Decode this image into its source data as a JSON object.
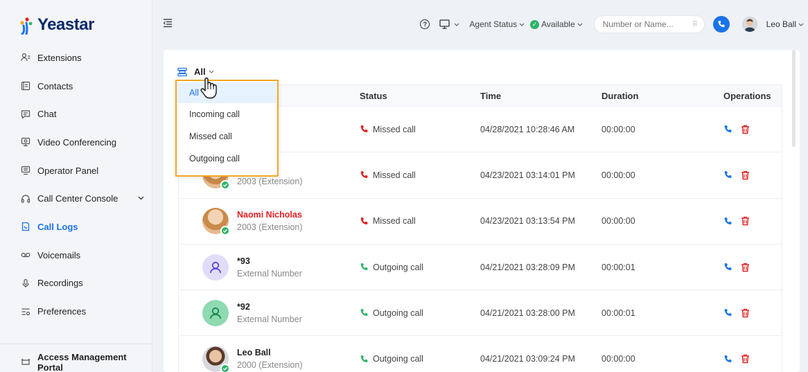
{
  "brand": {
    "name": "Yeastar"
  },
  "sidebar": {
    "items": [
      {
        "label": "Extensions",
        "icon": "extensions-icon",
        "active": false
      },
      {
        "label": "Contacts",
        "icon": "contacts-icon",
        "active": false
      },
      {
        "label": "Chat",
        "icon": "chat-icon",
        "active": false
      },
      {
        "label": "Video Conferencing",
        "icon": "video-conferencing-icon",
        "active": false
      },
      {
        "label": "Operator Panel",
        "icon": "operator-panel-icon",
        "active": false
      },
      {
        "label": "Call Center Console",
        "icon": "headset-icon",
        "active": false,
        "expandable": true
      },
      {
        "label": "Call Logs",
        "icon": "call-logs-icon",
        "active": true
      },
      {
        "label": "Voicemails",
        "icon": "voicemail-icon",
        "active": false
      },
      {
        "label": "Recordings",
        "icon": "microphone-icon",
        "active": false
      },
      {
        "label": "Preferences",
        "icon": "preferences-icon",
        "active": false
      }
    ],
    "bottom": {
      "label": "Access Management Portal",
      "icon": "portal-icon"
    }
  },
  "topbar": {
    "agent_status_label": "Agent Status",
    "availability": "Available",
    "search_placeholder": "Number or Name...",
    "user_name": "Leo Ball",
    "colors": {
      "accent": "#1a73e8",
      "available": "#2fb36a"
    }
  },
  "filter": {
    "current": "All",
    "options": [
      "All",
      "Incoming call",
      "Missed call",
      "Outgoing call"
    ],
    "selected_index": 0
  },
  "table": {
    "columns": {
      "name": "",
      "status": "Status",
      "time": "Time",
      "duration": "Duration",
      "operations": "Operations"
    },
    "rows": [
      {
        "name": "lner",
        "sub": "sion)",
        "avatar": "photo-f",
        "online": false,
        "missed": true,
        "status": "Missed call",
        "status_type": "missed",
        "time": "04/28/2021 10:28:46 AM",
        "duration": "00:00:00"
      },
      {
        "name": "olas",
        "sub": "2003 (Extension)",
        "avatar": "photo-f",
        "online": true,
        "missed": true,
        "status": "Missed call",
        "status_type": "missed",
        "time": "04/23/2021 03:14:01 PM",
        "duration": "00:00:00"
      },
      {
        "name": "Naomi Nicholas",
        "sub": "2003 (Extension)",
        "avatar": "photo-f",
        "online": true,
        "missed": true,
        "status": "Missed call",
        "status_type": "missed",
        "time": "04/23/2021 03:13:54 PM",
        "duration": "00:00:00"
      },
      {
        "name": "*93",
        "sub": "External Number",
        "avatar": "ext-purple",
        "online": false,
        "missed": false,
        "status": "Outgoing call",
        "status_type": "outgoing",
        "time": "04/21/2021 03:28:09 PM",
        "duration": "00:00:01"
      },
      {
        "name": "*92",
        "sub": "External Number",
        "avatar": "ext-green",
        "online": false,
        "missed": false,
        "status": "Outgoing call",
        "status_type": "outgoing",
        "time": "04/21/2021 03:28:00 PM",
        "duration": "00:00:01"
      },
      {
        "name": "Leo Ball",
        "sub": "2000 (Extension)",
        "avatar": "photo-m",
        "online": true,
        "missed": false,
        "status": "Outgoing call",
        "status_type": "outgoing",
        "time": "04/21/2021 03:09:24 PM",
        "duration": "00:00:00"
      }
    ]
  },
  "colors": {
    "missed": "#e02020",
    "outgoing": "#2fb36a",
    "highlight": "#f5a623",
    "delete": "#e02020"
  }
}
